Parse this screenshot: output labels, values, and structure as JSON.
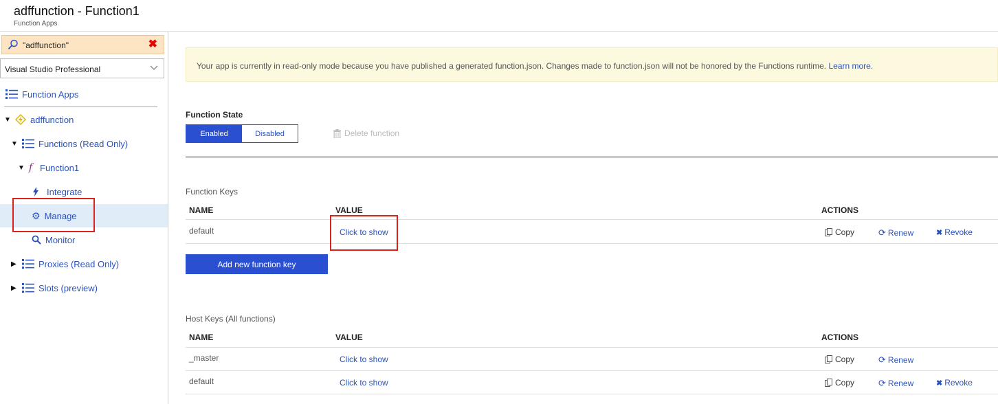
{
  "header": {
    "title": "adffunction - Function1",
    "subtitle": "Function Apps"
  },
  "sidebar": {
    "search": {
      "value": "\"adffunction\""
    },
    "subscription": {
      "selected": "Visual Studio Professional"
    },
    "root": {
      "label": "Function Apps"
    },
    "tree": [
      {
        "label": "adffunction"
      },
      {
        "label": "Functions (Read Only)"
      },
      {
        "label": "Function1"
      },
      {
        "label": "Integrate"
      },
      {
        "label": "Manage"
      },
      {
        "label": "Monitor"
      },
      {
        "label": "Proxies (Read Only)"
      },
      {
        "label": "Slots (preview)"
      }
    ]
  },
  "main": {
    "banner": {
      "text": "Your app is currently in read-only mode because you have published a generated function.json. Changes made to function.json will not be honored by the Functions runtime.",
      "link": "Learn more."
    },
    "function_state": {
      "label": "Function State",
      "enabled": "Enabled",
      "disabled": "Disabled",
      "delete": "Delete function"
    },
    "function_keys": {
      "title": "Function Keys",
      "columns": {
        "name": "NAME",
        "value": "VALUE",
        "actions": "ACTIONS"
      },
      "rows": [
        {
          "name": "default",
          "value": "Click to show"
        }
      ],
      "add_button": "Add new function key"
    },
    "host_keys": {
      "title": "Host Keys (All functions)",
      "columns": {
        "name": "NAME",
        "value": "VALUE",
        "actions": "ACTIONS"
      },
      "rows": [
        {
          "name": "_master",
          "value": "Click to show"
        },
        {
          "name": "default",
          "value": "Click to show"
        }
      ]
    },
    "actions": {
      "copy": "Copy",
      "renew": "Renew",
      "revoke": "Revoke"
    }
  },
  "colors": {
    "accent": "#2a4fd1",
    "link": "#2a52be",
    "highlight_box": "#d9221c",
    "banner_bg": "#fdf9df",
    "search_bg": "#fde5c4"
  }
}
